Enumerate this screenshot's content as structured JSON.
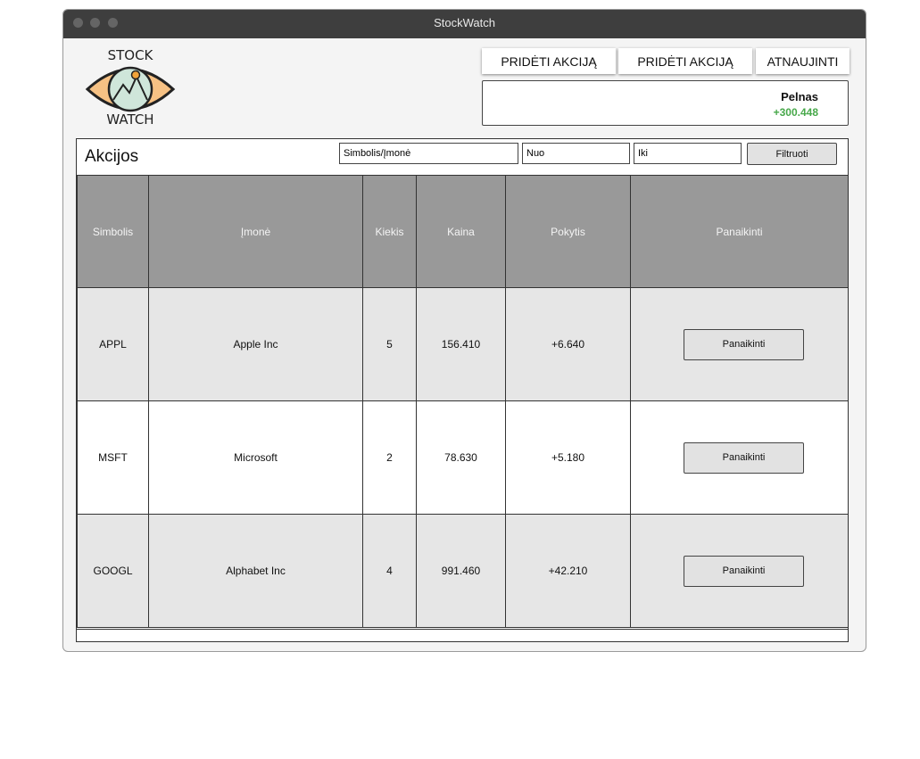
{
  "window": {
    "title": "StockWatch"
  },
  "logo": {
    "line1": "STOCK",
    "line2": "WATCH"
  },
  "toolbar": {
    "add_label_1": "PRIDĖTI AKCIJĄ",
    "add_label_2": "PRIDĖTI AKCIJĄ",
    "refresh_label": "ATNAUJINTI"
  },
  "profit": {
    "label": "Pelnas",
    "value": "+300.448",
    "value_color": "#47a84a"
  },
  "stocks": {
    "title": "Akcijos",
    "filter": {
      "symbol_value": "Simbolis/Įmonė",
      "from_value": "Nuo",
      "to_value": "Iki",
      "button_label": "Filtruoti"
    },
    "columns": [
      "Simbolis",
      "Įmonė",
      "Kiekis",
      "Kaina",
      "Pokytis",
      "Panaikinti"
    ],
    "rows": [
      {
        "symbol": "APPL",
        "company": "Apple Inc",
        "quantity": "5",
        "price": "156.410",
        "change": "+6.640",
        "delete_label": "Panaikinti"
      },
      {
        "symbol": "MSFT",
        "company": "Microsoft",
        "quantity": "2",
        "price": "78.630",
        "change": "+5.180",
        "delete_label": "Panaikinti"
      },
      {
        "symbol": "GOOGL",
        "company": "Alphabet Inc",
        "quantity": "4",
        "price": "991.460",
        "change": "+42.210",
        "delete_label": "Panaikinti"
      }
    ]
  }
}
